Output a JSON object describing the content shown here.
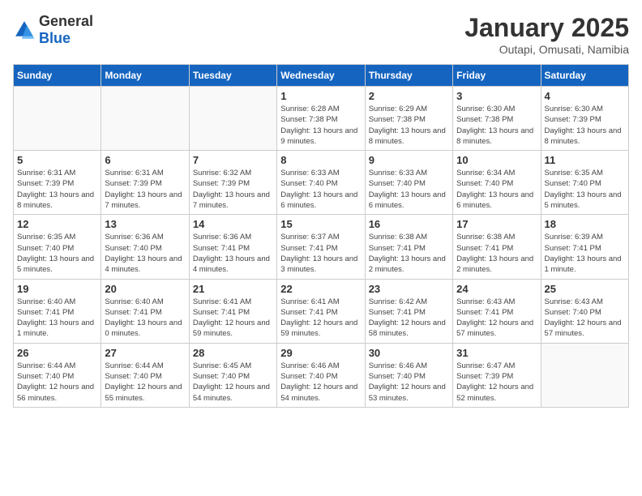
{
  "logo": {
    "general": "General",
    "blue": "Blue"
  },
  "title": "January 2025",
  "subtitle": "Outapi, Omusati, Namibia",
  "days_of_week": [
    "Sunday",
    "Monday",
    "Tuesday",
    "Wednesday",
    "Thursday",
    "Friday",
    "Saturday"
  ],
  "weeks": [
    [
      {
        "day": "",
        "info": ""
      },
      {
        "day": "",
        "info": ""
      },
      {
        "day": "",
        "info": ""
      },
      {
        "day": "1",
        "info": "Sunrise: 6:28 AM\nSunset: 7:38 PM\nDaylight: 13 hours and 9 minutes."
      },
      {
        "day": "2",
        "info": "Sunrise: 6:29 AM\nSunset: 7:38 PM\nDaylight: 13 hours and 8 minutes."
      },
      {
        "day": "3",
        "info": "Sunrise: 6:30 AM\nSunset: 7:38 PM\nDaylight: 13 hours and 8 minutes."
      },
      {
        "day": "4",
        "info": "Sunrise: 6:30 AM\nSunset: 7:39 PM\nDaylight: 13 hours and 8 minutes."
      }
    ],
    [
      {
        "day": "5",
        "info": "Sunrise: 6:31 AM\nSunset: 7:39 PM\nDaylight: 13 hours and 8 minutes."
      },
      {
        "day": "6",
        "info": "Sunrise: 6:31 AM\nSunset: 7:39 PM\nDaylight: 13 hours and 7 minutes."
      },
      {
        "day": "7",
        "info": "Sunrise: 6:32 AM\nSunset: 7:39 PM\nDaylight: 13 hours and 7 minutes."
      },
      {
        "day": "8",
        "info": "Sunrise: 6:33 AM\nSunset: 7:40 PM\nDaylight: 13 hours and 6 minutes."
      },
      {
        "day": "9",
        "info": "Sunrise: 6:33 AM\nSunset: 7:40 PM\nDaylight: 13 hours and 6 minutes."
      },
      {
        "day": "10",
        "info": "Sunrise: 6:34 AM\nSunset: 7:40 PM\nDaylight: 13 hours and 6 minutes."
      },
      {
        "day": "11",
        "info": "Sunrise: 6:35 AM\nSunset: 7:40 PM\nDaylight: 13 hours and 5 minutes."
      }
    ],
    [
      {
        "day": "12",
        "info": "Sunrise: 6:35 AM\nSunset: 7:40 PM\nDaylight: 13 hours and 5 minutes."
      },
      {
        "day": "13",
        "info": "Sunrise: 6:36 AM\nSunset: 7:40 PM\nDaylight: 13 hours and 4 minutes."
      },
      {
        "day": "14",
        "info": "Sunrise: 6:36 AM\nSunset: 7:41 PM\nDaylight: 13 hours and 4 minutes."
      },
      {
        "day": "15",
        "info": "Sunrise: 6:37 AM\nSunset: 7:41 PM\nDaylight: 13 hours and 3 minutes."
      },
      {
        "day": "16",
        "info": "Sunrise: 6:38 AM\nSunset: 7:41 PM\nDaylight: 13 hours and 2 minutes."
      },
      {
        "day": "17",
        "info": "Sunrise: 6:38 AM\nSunset: 7:41 PM\nDaylight: 13 hours and 2 minutes."
      },
      {
        "day": "18",
        "info": "Sunrise: 6:39 AM\nSunset: 7:41 PM\nDaylight: 13 hours and 1 minute."
      }
    ],
    [
      {
        "day": "19",
        "info": "Sunrise: 6:40 AM\nSunset: 7:41 PM\nDaylight: 13 hours and 1 minute."
      },
      {
        "day": "20",
        "info": "Sunrise: 6:40 AM\nSunset: 7:41 PM\nDaylight: 13 hours and 0 minutes."
      },
      {
        "day": "21",
        "info": "Sunrise: 6:41 AM\nSunset: 7:41 PM\nDaylight: 12 hours and 59 minutes."
      },
      {
        "day": "22",
        "info": "Sunrise: 6:41 AM\nSunset: 7:41 PM\nDaylight: 12 hours and 59 minutes."
      },
      {
        "day": "23",
        "info": "Sunrise: 6:42 AM\nSunset: 7:41 PM\nDaylight: 12 hours and 58 minutes."
      },
      {
        "day": "24",
        "info": "Sunrise: 6:43 AM\nSunset: 7:41 PM\nDaylight: 12 hours and 57 minutes."
      },
      {
        "day": "25",
        "info": "Sunrise: 6:43 AM\nSunset: 7:40 PM\nDaylight: 12 hours and 57 minutes."
      }
    ],
    [
      {
        "day": "26",
        "info": "Sunrise: 6:44 AM\nSunset: 7:40 PM\nDaylight: 12 hours and 56 minutes."
      },
      {
        "day": "27",
        "info": "Sunrise: 6:44 AM\nSunset: 7:40 PM\nDaylight: 12 hours and 55 minutes."
      },
      {
        "day": "28",
        "info": "Sunrise: 6:45 AM\nSunset: 7:40 PM\nDaylight: 12 hours and 54 minutes."
      },
      {
        "day": "29",
        "info": "Sunrise: 6:46 AM\nSunset: 7:40 PM\nDaylight: 12 hours and 54 minutes."
      },
      {
        "day": "30",
        "info": "Sunrise: 6:46 AM\nSunset: 7:40 PM\nDaylight: 12 hours and 53 minutes."
      },
      {
        "day": "31",
        "info": "Sunrise: 6:47 AM\nSunset: 7:39 PM\nDaylight: 12 hours and 52 minutes."
      },
      {
        "day": "",
        "info": ""
      }
    ]
  ]
}
